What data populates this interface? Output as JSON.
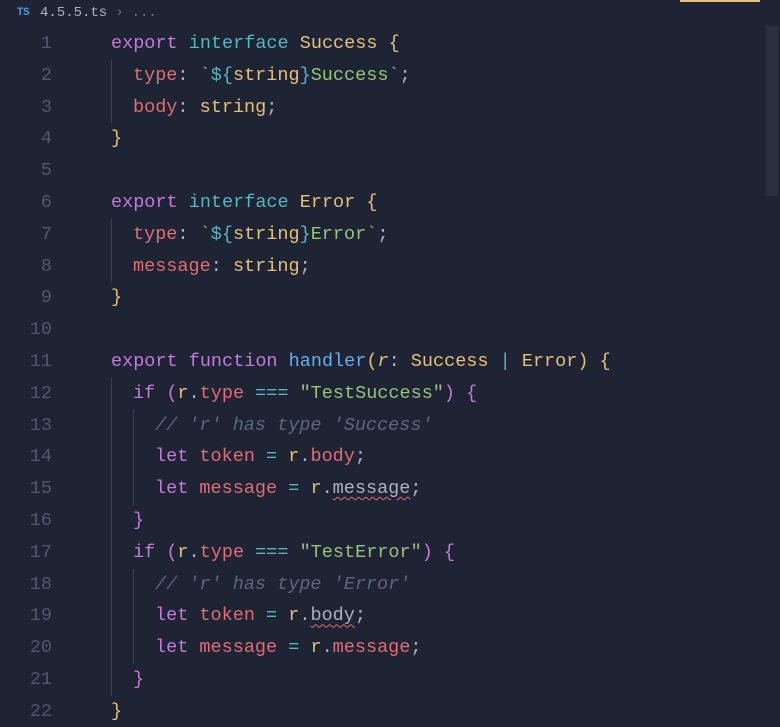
{
  "breadcrumb": {
    "icon_label": "TS",
    "file": "4.5.5.ts",
    "sep": "›",
    "rest": "..."
  },
  "code": {
    "lines": [
      {
        "n": 1,
        "indent": 1,
        "tokens": [
          {
            "t": "export ",
            "c": "tk-keyword"
          },
          {
            "t": "interface ",
            "c": "tk-interface"
          },
          {
            "t": "Success ",
            "c": "tk-type"
          },
          {
            "t": "{",
            "c": "tk-brace"
          }
        ]
      },
      {
        "n": 2,
        "indent": 2,
        "guides": [
          1
        ],
        "tokens": [
          {
            "t": "type",
            "c": "tk-prop"
          },
          {
            "t": ": ",
            "c": "tk-punc"
          },
          {
            "t": "`",
            "c": "tk-tmpl"
          },
          {
            "t": "${",
            "c": "tk-tmplexp"
          },
          {
            "t": "string",
            "c": "tk-type"
          },
          {
            "t": "}",
            "c": "tk-tmplexp"
          },
          {
            "t": "Success",
            "c": "tk-tmpl"
          },
          {
            "t": "`",
            "c": "tk-tmpl"
          },
          {
            "t": ";",
            "c": "tk-punc"
          }
        ]
      },
      {
        "n": 3,
        "indent": 2,
        "guides": [
          1
        ],
        "tokens": [
          {
            "t": "body",
            "c": "tk-prop"
          },
          {
            "t": ": ",
            "c": "tk-punc"
          },
          {
            "t": "string",
            "c": "tk-type"
          },
          {
            "t": ";",
            "c": "tk-punc"
          }
        ]
      },
      {
        "n": 4,
        "indent": 1,
        "tokens": [
          {
            "t": "}",
            "c": "tk-brace"
          }
        ]
      },
      {
        "n": 5,
        "indent": 0,
        "tokens": []
      },
      {
        "n": 6,
        "indent": 1,
        "tokens": [
          {
            "t": "export ",
            "c": "tk-keyword"
          },
          {
            "t": "interface ",
            "c": "tk-interface"
          },
          {
            "t": "Error ",
            "c": "tk-type"
          },
          {
            "t": "{",
            "c": "tk-brace"
          }
        ]
      },
      {
        "n": 7,
        "indent": 2,
        "guides": [
          1
        ],
        "tokens": [
          {
            "t": "type",
            "c": "tk-prop"
          },
          {
            "t": ": ",
            "c": "tk-punc"
          },
          {
            "t": "`",
            "c": "tk-tmpl"
          },
          {
            "t": "${",
            "c": "tk-tmplexp"
          },
          {
            "t": "string",
            "c": "tk-type"
          },
          {
            "t": "}",
            "c": "tk-tmplexp"
          },
          {
            "t": "Error",
            "c": "tk-tmpl"
          },
          {
            "t": "`",
            "c": "tk-tmpl"
          },
          {
            "t": ";",
            "c": "tk-punc"
          }
        ]
      },
      {
        "n": 8,
        "indent": 2,
        "guides": [
          1
        ],
        "tokens": [
          {
            "t": "message",
            "c": "tk-prop"
          },
          {
            "t": ": ",
            "c": "tk-punc"
          },
          {
            "t": "string",
            "c": "tk-type"
          },
          {
            "t": ";",
            "c": "tk-punc"
          }
        ]
      },
      {
        "n": 9,
        "indent": 1,
        "tokens": [
          {
            "t": "}",
            "c": "tk-brace"
          }
        ]
      },
      {
        "n": 10,
        "indent": 0,
        "tokens": []
      },
      {
        "n": 11,
        "indent": 1,
        "tokens": [
          {
            "t": "export ",
            "c": "tk-keyword"
          },
          {
            "t": "function ",
            "c": "tk-storage"
          },
          {
            "t": "handler",
            "c": "tk-func"
          },
          {
            "t": "(",
            "c": "tk-brace"
          },
          {
            "t": "r",
            "c": "tk-param"
          },
          {
            "t": ": ",
            "c": "tk-punc"
          },
          {
            "t": "Success ",
            "c": "tk-type"
          },
          {
            "t": "| ",
            "c": "tk-op"
          },
          {
            "t": "Error",
            "c": "tk-type"
          },
          {
            "t": ") ",
            "c": "tk-brace"
          },
          {
            "t": "{",
            "c": "tk-brace"
          }
        ]
      },
      {
        "n": 12,
        "indent": 2,
        "guides": [
          1
        ],
        "tokens": [
          {
            "t": "if ",
            "c": "tk-keyword"
          },
          {
            "t": "(",
            "c": "tk-brace2"
          },
          {
            "t": "r",
            "c": "tk-var"
          },
          {
            "t": ".",
            "c": "tk-punc"
          },
          {
            "t": "type",
            "c": "tk-member"
          },
          {
            "t": " === ",
            "c": "tk-op"
          },
          {
            "t": "\"TestSuccess\"",
            "c": "tk-string"
          },
          {
            "t": ") ",
            "c": "tk-brace2"
          },
          {
            "t": "{",
            "c": "tk-brace2"
          }
        ]
      },
      {
        "n": 13,
        "indent": 3,
        "guides": [
          1,
          2
        ],
        "tokens": [
          {
            "t": "// 'r' has type 'Success'",
            "c": "tk-comment"
          }
        ]
      },
      {
        "n": 14,
        "indent": 3,
        "guides": [
          1,
          2
        ],
        "tokens": [
          {
            "t": "let ",
            "c": "tk-storage"
          },
          {
            "t": "token",
            "c": "tk-varlocal"
          },
          {
            "t": " = ",
            "c": "tk-op"
          },
          {
            "t": "r",
            "c": "tk-var"
          },
          {
            "t": ".",
            "c": "tk-punc"
          },
          {
            "t": "body",
            "c": "tk-member"
          },
          {
            "t": ";",
            "c": "tk-punc"
          }
        ]
      },
      {
        "n": 15,
        "indent": 3,
        "guides": [
          1,
          2
        ],
        "tokens": [
          {
            "t": "let ",
            "c": "tk-storage"
          },
          {
            "t": "message",
            "c": "tk-varlocal"
          },
          {
            "t": " = ",
            "c": "tk-op"
          },
          {
            "t": "r",
            "c": "tk-var"
          },
          {
            "t": ".",
            "c": "tk-punc"
          },
          {
            "t": "message",
            "c": "tk-membererr err-underline"
          },
          {
            "t": ";",
            "c": "tk-punc"
          }
        ]
      },
      {
        "n": 16,
        "indent": 2,
        "guides": [
          1
        ],
        "tokens": [
          {
            "t": "}",
            "c": "tk-brace2"
          }
        ]
      },
      {
        "n": 17,
        "indent": 2,
        "guides": [
          1
        ],
        "tokens": [
          {
            "t": "if ",
            "c": "tk-keyword"
          },
          {
            "t": "(",
            "c": "tk-brace2"
          },
          {
            "t": "r",
            "c": "tk-var"
          },
          {
            "t": ".",
            "c": "tk-punc"
          },
          {
            "t": "type",
            "c": "tk-member"
          },
          {
            "t": " === ",
            "c": "tk-op"
          },
          {
            "t": "\"TestError\"",
            "c": "tk-string"
          },
          {
            "t": ") ",
            "c": "tk-brace2"
          },
          {
            "t": "{",
            "c": "tk-brace2"
          }
        ]
      },
      {
        "n": 18,
        "indent": 3,
        "guides": [
          1,
          2
        ],
        "tokens": [
          {
            "t": "// 'r' has type 'Error'",
            "c": "tk-comment"
          }
        ]
      },
      {
        "n": 19,
        "indent": 3,
        "guides": [
          1,
          2
        ],
        "tokens": [
          {
            "t": "let ",
            "c": "tk-storage"
          },
          {
            "t": "token",
            "c": "tk-varlocal"
          },
          {
            "t": " = ",
            "c": "tk-op"
          },
          {
            "t": "r",
            "c": "tk-var"
          },
          {
            "t": ".",
            "c": "tk-punc"
          },
          {
            "t": "body",
            "c": "tk-membererr err-underline"
          },
          {
            "t": ";",
            "c": "tk-punc"
          }
        ]
      },
      {
        "n": 20,
        "indent": 3,
        "guides": [
          1,
          2
        ],
        "tokens": [
          {
            "t": "let ",
            "c": "tk-storage"
          },
          {
            "t": "message",
            "c": "tk-varlocal"
          },
          {
            "t": " = ",
            "c": "tk-op"
          },
          {
            "t": "r",
            "c": "tk-var"
          },
          {
            "t": ".",
            "c": "tk-punc"
          },
          {
            "t": "message",
            "c": "tk-member"
          },
          {
            "t": ";",
            "c": "tk-punc"
          }
        ]
      },
      {
        "n": 21,
        "indent": 2,
        "guides": [
          1
        ],
        "tokens": [
          {
            "t": "}",
            "c": "tk-brace2"
          }
        ]
      },
      {
        "n": 22,
        "indent": 1,
        "tokens": [
          {
            "t": "}",
            "c": "tk-brace"
          }
        ]
      }
    ]
  },
  "colors": {
    "background": "#1e2433",
    "gutter": "#4e586e",
    "error_underline": "#e06c75",
    "lint_bar": "#e5c07b"
  }
}
